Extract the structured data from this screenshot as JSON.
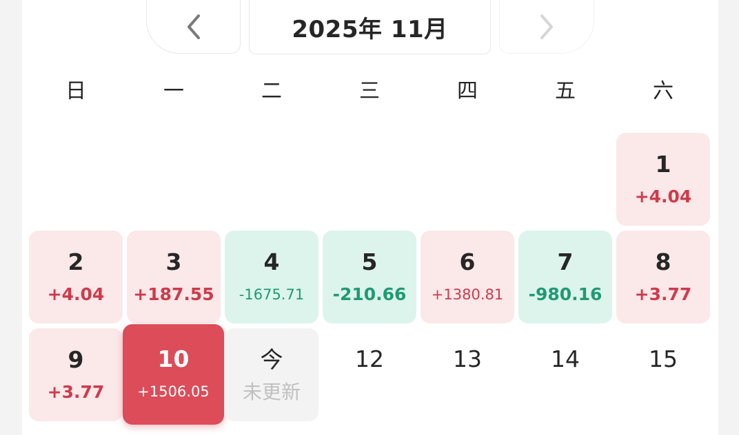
{
  "header": {
    "month_title": "2025年 11月",
    "prev_icon": "chevron-left-icon",
    "next_icon": "chevron-right-icon"
  },
  "weekdays": [
    "日",
    "一",
    "二",
    "三",
    "四",
    "五",
    "六"
  ],
  "colors": {
    "gain_bg": "#fbe8e9",
    "gain_text": "#cf3a4a",
    "loss_bg": "#dcf4ec",
    "loss_text": "#1f9a73",
    "selected_bg": "#dc4c59"
  },
  "days": [
    {
      "num": "1",
      "pnl": "+4.04",
      "status": "gain"
    },
    {
      "num": "2",
      "pnl": "+4.04",
      "status": "gain"
    },
    {
      "num": "3",
      "pnl": "+187.55",
      "status": "gain"
    },
    {
      "num": "4",
      "pnl": "-1675.71",
      "status": "loss"
    },
    {
      "num": "5",
      "pnl": "-210.66",
      "status": "loss"
    },
    {
      "num": "6",
      "pnl": "+1380.81",
      "status": "gain"
    },
    {
      "num": "7",
      "pnl": "-980.16",
      "status": "loss"
    },
    {
      "num": "8",
      "pnl": "+3.77",
      "status": "gain"
    },
    {
      "num": "9",
      "pnl": "+3.77",
      "status": "gain"
    },
    {
      "num": "10",
      "pnl": "+1506.05",
      "status": "selected"
    },
    {
      "num": "今",
      "pnl": "未更新",
      "status": "today"
    },
    {
      "num": "12",
      "pnl": "",
      "status": "plain"
    },
    {
      "num": "13",
      "pnl": "",
      "status": "plain"
    },
    {
      "num": "14",
      "pnl": "",
      "status": "plain"
    },
    {
      "num": "15",
      "pnl": "",
      "status": "plain"
    }
  ]
}
